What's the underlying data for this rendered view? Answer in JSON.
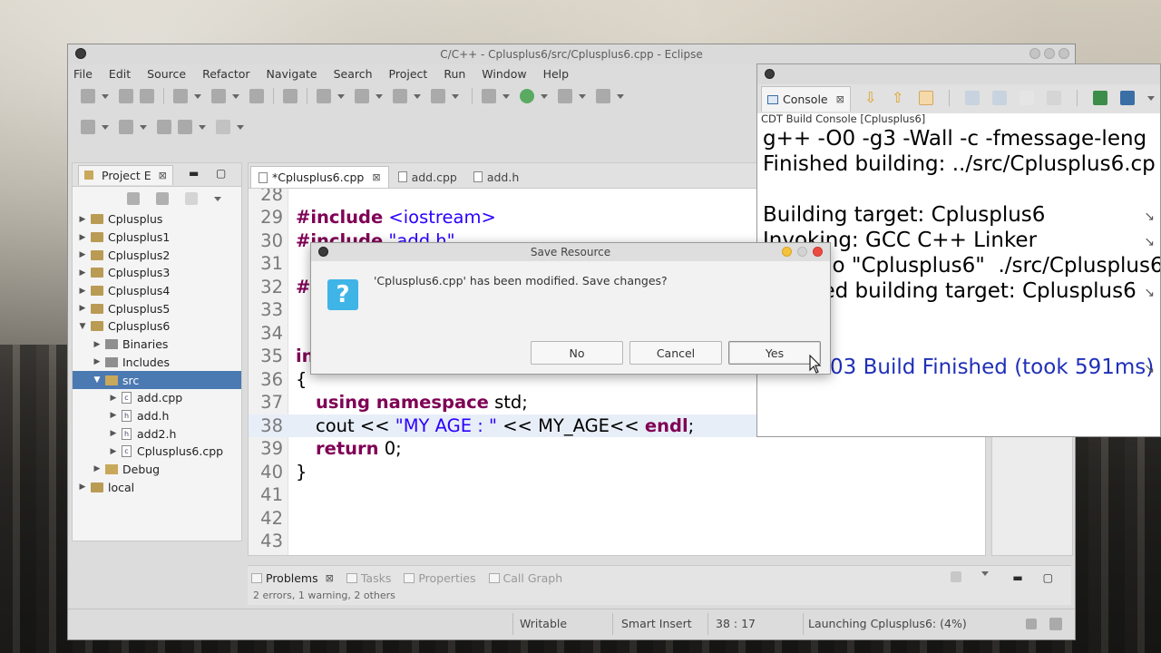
{
  "eclipse": {
    "title": "C/C++ - Cplusplus6/src/Cplusplus6.cpp - Eclipse",
    "menu": [
      "File",
      "Edit",
      "Source",
      "Refactor",
      "Navigate",
      "Search",
      "Project",
      "Run",
      "Window",
      "Help"
    ]
  },
  "explorer": {
    "tab_label": "Project E",
    "close_glyph": "⊠",
    "items": [
      {
        "label": "Cplusplus",
        "twisty": "▶",
        "kind": "project"
      },
      {
        "label": "Cplusplus1",
        "twisty": "▶",
        "kind": "project"
      },
      {
        "label": "Cplusplus2",
        "twisty": "▶",
        "kind": "project"
      },
      {
        "label": "Cplusplus3",
        "twisty": "▶",
        "kind": "project"
      },
      {
        "label": "Cplusplus4",
        "twisty": "▶",
        "kind": "project"
      },
      {
        "label": "Cplusplus5",
        "twisty": "▶",
        "kind": "project"
      },
      {
        "label": "Cplusplus6",
        "twisty": "▼",
        "kind": "project"
      },
      {
        "label": "Binaries",
        "twisty": "▶",
        "kind": "folder"
      },
      {
        "label": "Includes",
        "twisty": "▶",
        "kind": "folder"
      },
      {
        "label": "src",
        "twisty": "▼",
        "kind": "folder"
      },
      {
        "label": "add.cpp",
        "twisty": "▶",
        "kind": "file"
      },
      {
        "label": "add.h",
        "twisty": "▶",
        "kind": "file"
      },
      {
        "label": "add2.h",
        "twisty": "▶",
        "kind": "file"
      },
      {
        "label": "Cplusplus6.cpp",
        "twisty": "▶",
        "kind": "file"
      },
      {
        "label": "Debug",
        "twisty": "▶",
        "kind": "folder"
      },
      {
        "label": "local",
        "twisty": "▶",
        "kind": "project"
      }
    ]
  },
  "editor": {
    "tabs": [
      {
        "label": "*Cplusplus6.cpp",
        "close": "⊠"
      },
      {
        "label": "add.cpp"
      },
      {
        "label": "add.h"
      }
    ],
    "line_numbers": [
      "28",
      "29",
      "30",
      "31",
      "32",
      "33",
      "34",
      "35",
      "36",
      "37",
      "38",
      "39",
      "40",
      "41",
      "42",
      "43"
    ],
    "code": {
      "l29_kw": "#include",
      "l29_rest": " <iostream>",
      "l30_kw": "#include",
      "l30_rest": " \"add.h\"",
      "l32": "#d",
      "l35": "in",
      "l36": "{",
      "l37_kw": "using namespace",
      "l37_rest": " std;",
      "l38_a": "cout << ",
      "l38_str": "\"MY AGE : \"",
      "l38_b": " << MY_AGE<< ",
      "l38_kw": "endl",
      "l38_c": ";",
      "l39_kw": "return",
      "l39_rest": " 0;",
      "l40": "}"
    }
  },
  "problems": {
    "tabs": [
      "Problems",
      "Tasks",
      "Properties",
      "Call Graph"
    ],
    "summary": "2 errors, 1 warning, 2 others"
  },
  "statusbar": {
    "mode": "Writable",
    "insert": "Smart Insert",
    "position": "38 : 17",
    "task": "Launching Cplusplus6: (4%)"
  },
  "console": {
    "tab_label": "Console",
    "header": "CDT Build Console [Cplusplus6]",
    "lines": [
      "g++ -O0 -g3 -Wall -c -fmessage-leng",
      "Finished building: ../src/Cplusplus6.cp",
      "",
      "Building target: Cplusplus6",
      "Invoking: GCC C++ Linker",
      "g++  -o \"Cplusplus6\"  ./src/Cplusplus6",
      "Finished building target: Cplusplus6",
      "",
      "",
      "13:23:03 Build Finished (took 591ms)"
    ]
  },
  "dialog": {
    "title": "Save Resource",
    "icon_glyph": "?",
    "message": "'Cplusplus6.cpp' has been modified. Save changes?",
    "buttons": {
      "no": "No",
      "cancel": "Cancel",
      "yes": "Yes"
    }
  }
}
